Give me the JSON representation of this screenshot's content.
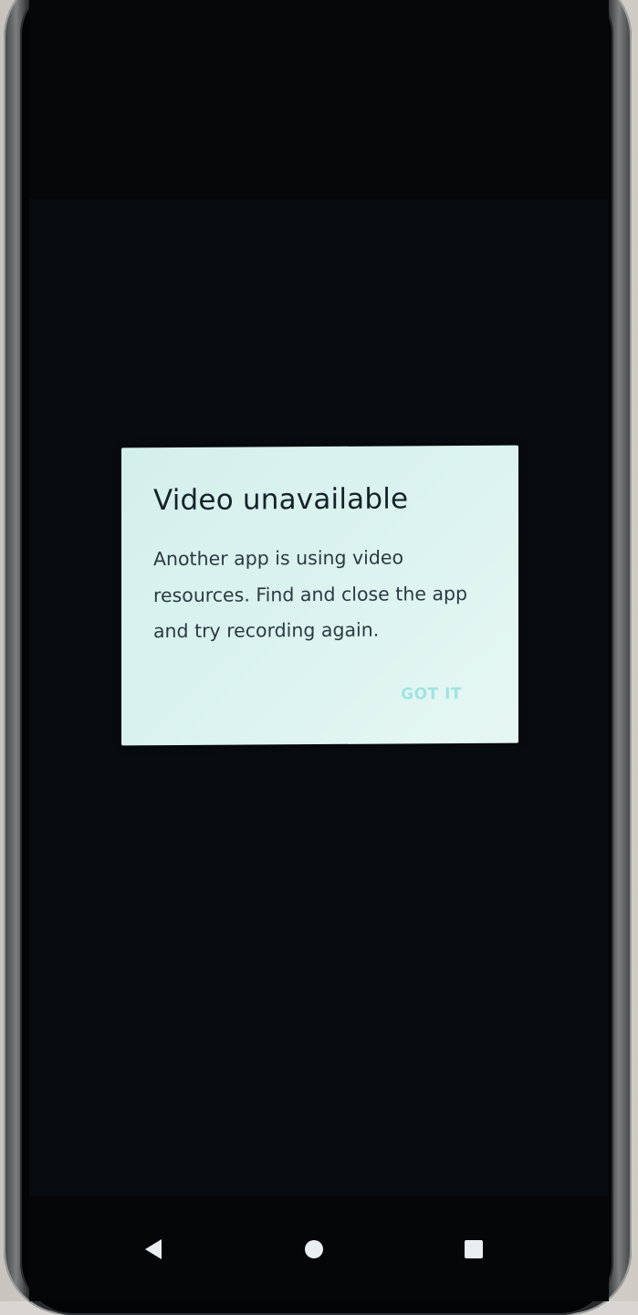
{
  "dialog": {
    "title": "Video unavailable",
    "message": "Another app is using video resources. Find and close the app and try recording again.",
    "action_label": "GOT IT"
  },
  "navigation": {
    "back_icon": "back-triangle",
    "home_icon": "home-circle",
    "recents_icon": "recents-square"
  },
  "colors": {
    "dialog_background": "#dcf3ef",
    "dialog_title": "#16222a",
    "dialog_body": "#2b3a42",
    "action_text": "#9fe4e2",
    "screen_background": "#0b0f13"
  }
}
